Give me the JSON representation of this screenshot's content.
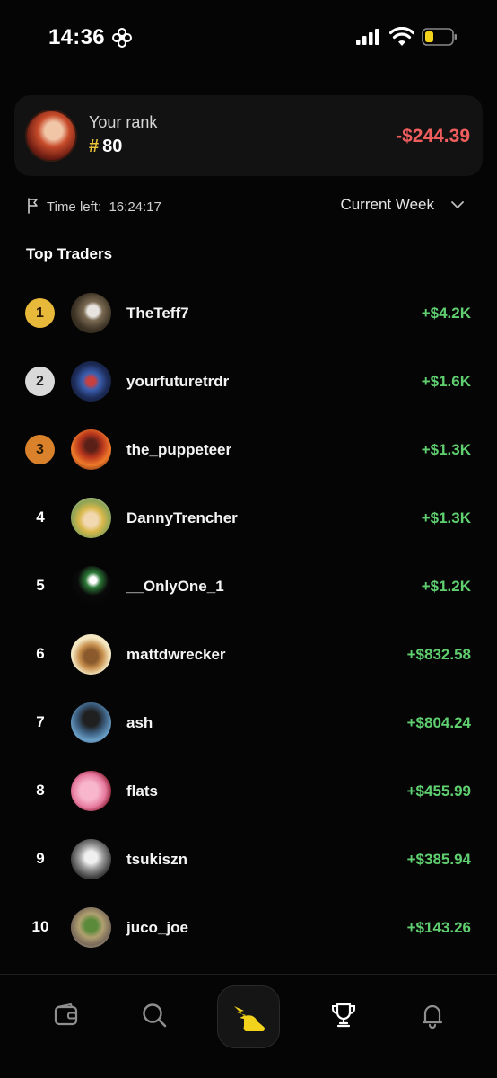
{
  "status_bar": {
    "time": "14:36"
  },
  "rank_card": {
    "label": "Your rank",
    "hash": "#",
    "rank": "80",
    "pnl": "-$244.39"
  },
  "time_row": {
    "label": "Time left:",
    "value": "16:24:17",
    "period": "Current Week"
  },
  "section_title": "Top Traders",
  "traders": [
    {
      "rank": "1",
      "name": "TheTeff7",
      "pnl": "+$4.2K"
    },
    {
      "rank": "2",
      "name": "yourfuturetrdr",
      "pnl": "+$1.6K"
    },
    {
      "rank": "3",
      "name": "the_puppeteer",
      "pnl": "+$1.3K"
    },
    {
      "rank": "4",
      "name": "DannyTrencher",
      "pnl": "+$1.3K"
    },
    {
      "rank": "5",
      "name": "__OnlyOne_1",
      "pnl": "+$1.2K"
    },
    {
      "rank": "6",
      "name": "mattdwrecker",
      "pnl": "+$832.58"
    },
    {
      "rank": "7",
      "name": "ash",
      "pnl": "+$804.24"
    },
    {
      "rank": "8",
      "name": "flats",
      "pnl": "+$455.99"
    },
    {
      "rank": "9",
      "name": "tsukiszn",
      "pnl": "+$385.94"
    },
    {
      "rank": "10",
      "name": "juco_joe",
      "pnl": "+$143.26"
    }
  ],
  "badge_colors": {
    "gold": "#e8b83a",
    "silver": "#d9d9d9",
    "bronze": "#d9822b"
  },
  "colors": {
    "positive": "#5fcf6f",
    "negative": "#ef5d5d",
    "accent": "#f2d21b"
  },
  "nav": {
    "items": [
      "wallet-icon",
      "search-icon",
      "winged-shoe-icon",
      "trophy-icon",
      "bell-icon"
    ],
    "active": "trophy-icon"
  }
}
